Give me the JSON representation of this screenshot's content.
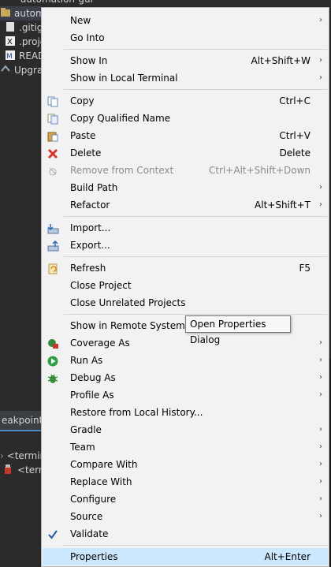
{
  "background": {
    "tree_items": [
      "automation-gui",
      "autom",
      ".gitig",
      ".proje",
      "READ",
      "Upgrade"
    ],
    "breakpoints_tab": "eakpoints",
    "console_items": [
      "<termina",
      "<term"
    ]
  },
  "menu": {
    "items": [
      {
        "label": "New",
        "shortcut": "",
        "submenu": true,
        "icon": "",
        "disabled": false
      },
      {
        "label": "Go Into",
        "shortcut": "",
        "submenu": false,
        "icon": "",
        "disabled": false
      },
      {
        "label": "Show In",
        "shortcut": "Alt+Shift+W",
        "submenu": true,
        "icon": "",
        "disabled": false
      },
      {
        "label": "Show in Local Terminal",
        "shortcut": "",
        "submenu": true,
        "icon": "",
        "disabled": false
      },
      {
        "label": "Copy",
        "shortcut": "Ctrl+C",
        "submenu": false,
        "icon": "copy-icon",
        "disabled": false
      },
      {
        "label": "Copy Qualified Name",
        "shortcut": "",
        "submenu": false,
        "icon": "copy-qualified-icon",
        "disabled": false
      },
      {
        "label": "Paste",
        "shortcut": "Ctrl+V",
        "submenu": false,
        "icon": "paste-icon",
        "disabled": false
      },
      {
        "label": "Delete",
        "shortcut": "Delete",
        "submenu": false,
        "icon": "delete-icon",
        "disabled": false
      },
      {
        "label": "Remove from Context",
        "shortcut": "Ctrl+Alt+Shift+Down",
        "submenu": false,
        "icon": "remove-context-icon",
        "disabled": true
      },
      {
        "label": "Build Path",
        "shortcut": "",
        "submenu": true,
        "icon": "",
        "disabled": false
      },
      {
        "label": "Refactor",
        "shortcut": "Alt+Shift+T",
        "submenu": true,
        "icon": "",
        "disabled": false
      },
      {
        "label": "Import...",
        "shortcut": "",
        "submenu": false,
        "icon": "import-icon",
        "disabled": false
      },
      {
        "label": "Export...",
        "shortcut": "",
        "submenu": false,
        "icon": "export-icon",
        "disabled": false
      },
      {
        "label": "Refresh",
        "shortcut": "F5",
        "submenu": false,
        "icon": "refresh-icon",
        "disabled": false
      },
      {
        "label": "Close Project",
        "shortcut": "",
        "submenu": false,
        "icon": "",
        "disabled": false
      },
      {
        "label": "Close Unrelated Projects",
        "shortcut": "",
        "submenu": false,
        "icon": "",
        "disabled": false
      },
      {
        "label": "Show in Remote Systems vi",
        "shortcut": "",
        "submenu": false,
        "icon": "",
        "disabled": false
      },
      {
        "label": "Coverage As",
        "shortcut": "",
        "submenu": true,
        "icon": "coverage-icon",
        "disabled": false
      },
      {
        "label": "Run As",
        "shortcut": "",
        "submenu": true,
        "icon": "run-icon",
        "disabled": false
      },
      {
        "label": "Debug As",
        "shortcut": "",
        "submenu": true,
        "icon": "debug-icon",
        "disabled": false
      },
      {
        "label": "Profile As",
        "shortcut": "",
        "submenu": true,
        "icon": "",
        "disabled": false
      },
      {
        "label": "Restore from Local History...",
        "shortcut": "",
        "submenu": false,
        "icon": "",
        "disabled": false
      },
      {
        "label": "Gradle",
        "shortcut": "",
        "submenu": true,
        "icon": "",
        "disabled": false
      },
      {
        "label": "Team",
        "shortcut": "",
        "submenu": true,
        "icon": "",
        "disabled": false
      },
      {
        "label": "Compare With",
        "shortcut": "",
        "submenu": true,
        "icon": "",
        "disabled": false
      },
      {
        "label": "Replace With",
        "shortcut": "",
        "submenu": true,
        "icon": "",
        "disabled": false
      },
      {
        "label": "Configure",
        "shortcut": "",
        "submenu": true,
        "icon": "",
        "disabled": false
      },
      {
        "label": "Source",
        "shortcut": "",
        "submenu": true,
        "icon": "",
        "disabled": false
      },
      {
        "label": "Validate",
        "shortcut": "",
        "submenu": false,
        "icon": "validate-check-icon",
        "disabled": false
      },
      {
        "label": "Properties",
        "shortcut": "Alt+Enter",
        "submenu": false,
        "icon": "",
        "disabled": false
      }
    ],
    "submenu_arrow": "›"
  },
  "tooltip": {
    "text": "Open Properties Dialog"
  }
}
